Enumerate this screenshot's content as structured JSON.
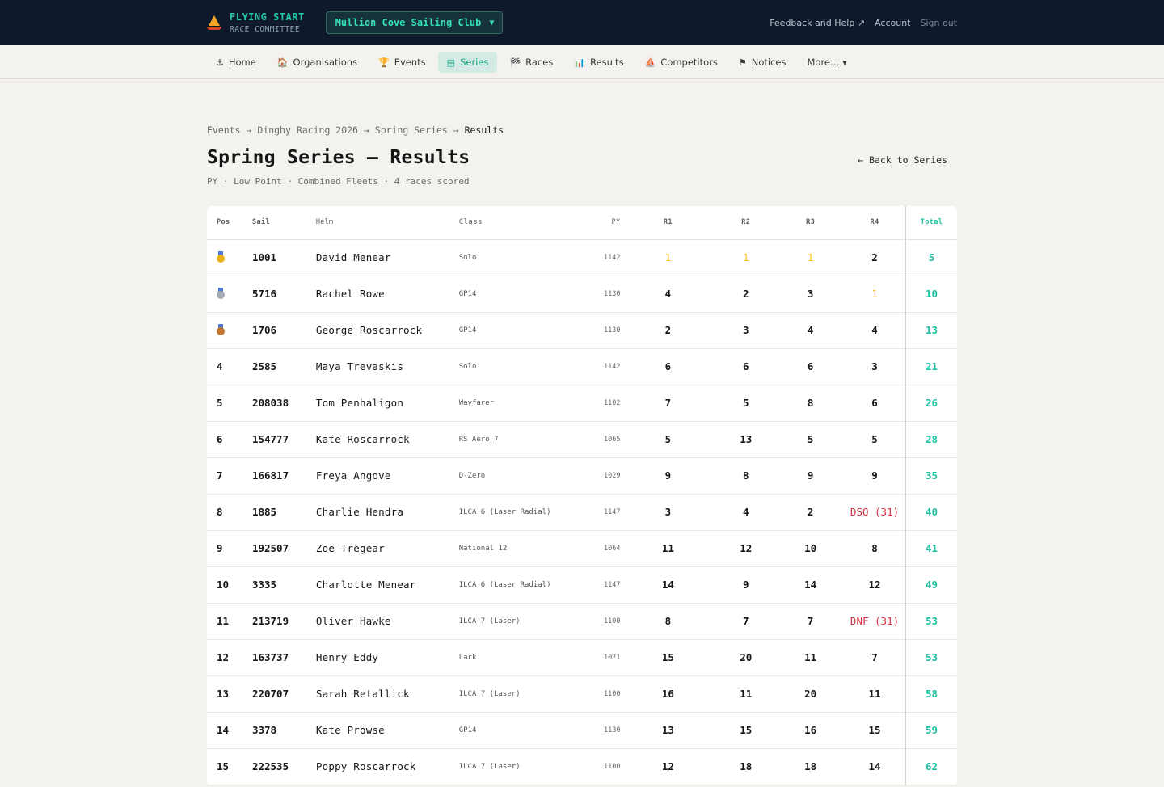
{
  "brand": {
    "name": "FLYING START",
    "subtitle": "RACE COMMITTEE"
  },
  "club_select": {
    "value": "Mullion Cove Sailing Club"
  },
  "top_links": {
    "feedback": "Feedback and Help ↗",
    "account": "Account",
    "signout": "Sign out"
  },
  "nav": [
    {
      "label": "Home",
      "icon": "⚓"
    },
    {
      "label": "Organisations",
      "icon": "🏠"
    },
    {
      "label": "Events",
      "icon": "🏆"
    },
    {
      "label": "Series",
      "icon": "▤",
      "active": true
    },
    {
      "label": "Races",
      "icon": "🏁"
    },
    {
      "label": "Results",
      "icon": "📊"
    },
    {
      "label": "Competitors",
      "icon": "⛵"
    },
    {
      "label": "Notices",
      "icon": "⚑"
    },
    {
      "label": "More… ▾",
      "icon": ""
    }
  ],
  "breadcrumb": {
    "events": "Events",
    "event": "Dinghy Racing 2026",
    "series": "Spring Series",
    "current": "Results",
    "sep": "→"
  },
  "page": {
    "title": "Spring Series — Results",
    "back": "← Back to Series",
    "subtitle": "PY · Low Point · Combined Fleets · 4 races scored"
  },
  "table": {
    "headers": {
      "pos": "Pos",
      "sail": "Sail",
      "helm": "Helm",
      "class": "Class",
      "py": "PY",
      "r1": "R1",
      "r2": "R2",
      "r3": "R3",
      "r4": "R4",
      "total": "Total"
    },
    "rows": [
      {
        "pos": "",
        "medal": "gold",
        "sail": "1001",
        "helm": "David Menear",
        "class": "Solo",
        "py": "1142",
        "r": [
          "1",
          "1",
          "1",
          "2"
        ],
        "total": "5"
      },
      {
        "pos": "",
        "medal": "silver",
        "sail": "5716",
        "helm": "Rachel Rowe",
        "class": "GP14",
        "py": "1130",
        "r": [
          "4",
          "2",
          "3",
          "1"
        ],
        "total": "10"
      },
      {
        "pos": "",
        "medal": "bronze",
        "sail": "1706",
        "helm": "George Roscarrock",
        "class": "GP14",
        "py": "1130",
        "r": [
          "2",
          "3",
          "4",
          "4"
        ],
        "total": "13"
      },
      {
        "pos": "4",
        "sail": "2585",
        "helm": "Maya Trevaskis",
        "class": "Solo",
        "py": "1142",
        "r": [
          "6",
          "6",
          "6",
          "3"
        ],
        "total": "21"
      },
      {
        "pos": "5",
        "sail": "208038",
        "helm": "Tom Penhaligon",
        "class": "Wayfarer",
        "py": "1102",
        "r": [
          "7",
          "5",
          "8",
          "6"
        ],
        "total": "26"
      },
      {
        "pos": "6",
        "sail": "154777",
        "helm": "Kate Roscarrock",
        "class": "RS Aero 7",
        "py": "1065",
        "r": [
          "5",
          "13",
          "5",
          "5"
        ],
        "total": "28"
      },
      {
        "pos": "7",
        "sail": "166817",
        "helm": "Freya Angove",
        "class": "D-Zero",
        "py": "1029",
        "r": [
          "9",
          "8",
          "9",
          "9"
        ],
        "total": "35"
      },
      {
        "pos": "8",
        "sail": "1885",
        "helm": "Charlie Hendra",
        "class": "ILCA 6 (Laser Radial)",
        "py": "1147",
        "r": [
          "3",
          "4",
          "2",
          "DSQ (31)"
        ],
        "total": "40"
      },
      {
        "pos": "9",
        "sail": "192507",
        "helm": "Zoe Tregear",
        "class": "National 12",
        "py": "1064",
        "r": [
          "11",
          "12",
          "10",
          "8"
        ],
        "total": "41"
      },
      {
        "pos": "10",
        "sail": "3335",
        "helm": "Charlotte Menear",
        "class": "ILCA 6 (Laser Radial)",
        "py": "1147",
        "r": [
          "14",
          "9",
          "14",
          "12"
        ],
        "total": "49"
      },
      {
        "pos": "11",
        "sail": "213719",
        "helm": "Oliver Hawke",
        "class": "ILCA 7 (Laser)",
        "py": "1100",
        "r": [
          "8",
          "7",
          "7",
          "DNF (31)"
        ],
        "total": "53"
      },
      {
        "pos": "12",
        "sail": "163737",
        "helm": "Henry Eddy",
        "class": "Lark",
        "py": "1071",
        "r": [
          "15",
          "20",
          "11",
          "7"
        ],
        "total": "53"
      },
      {
        "pos": "13",
        "sail": "220707",
        "helm": "Sarah Retallick",
        "class": "ILCA 7 (Laser)",
        "py": "1100",
        "r": [
          "16",
          "11",
          "20",
          "11"
        ],
        "total": "58"
      },
      {
        "pos": "14",
        "sail": "3378",
        "helm": "Kate Prowse",
        "class": "GP14",
        "py": "1130",
        "r": [
          "13",
          "15",
          "16",
          "15"
        ],
        "total": "59"
      },
      {
        "pos": "15",
        "sail": "222535",
        "helm": "Poppy Roscarrock",
        "class": "ILCA 7 (Laser)",
        "py": "1100",
        "r": [
          "12",
          "18",
          "18",
          "14"
        ],
        "total": "62"
      }
    ]
  }
}
